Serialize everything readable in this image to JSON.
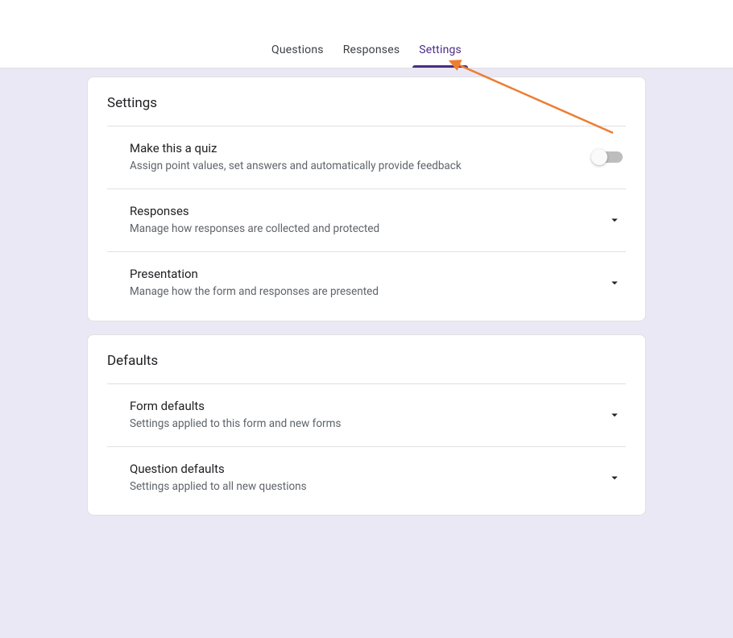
{
  "tabs": {
    "questions": "Questions",
    "responses": "Responses",
    "settings": "Settings"
  },
  "settings_card": {
    "title": "Settings",
    "quiz": {
      "title": "Make this a quiz",
      "desc": "Assign point values, set answers and automatically provide feedback"
    },
    "responses": {
      "title": "Responses",
      "desc": "Manage how responses are collected and protected"
    },
    "presentation": {
      "title": "Presentation",
      "desc": "Manage how the form and responses are presented"
    }
  },
  "defaults_card": {
    "title": "Defaults",
    "form_defaults": {
      "title": "Form defaults",
      "desc": "Settings applied to this form and new forms"
    },
    "question_defaults": {
      "title": "Question defaults",
      "desc": "Settings applied to all new questions"
    }
  },
  "colors": {
    "accent": "#4c2b87",
    "page_bg": "#ebe8f5",
    "annotation": "#ed7d31"
  }
}
